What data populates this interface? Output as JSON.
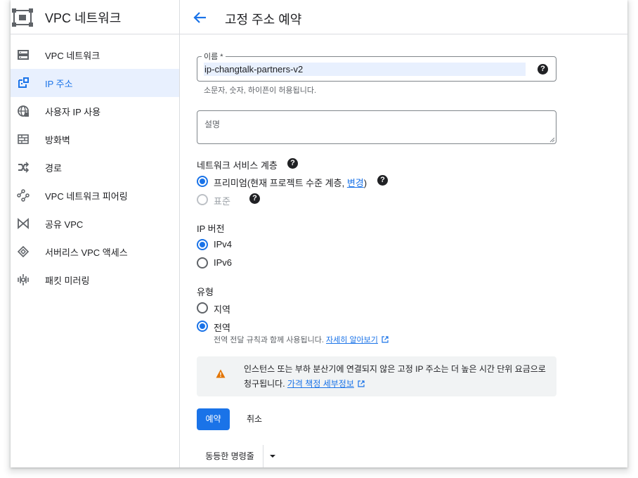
{
  "sidebar": {
    "title": "VPC 네트워크",
    "items": [
      {
        "label": "VPC 네트워크",
        "icon": "vpc-network-icon",
        "active": false
      },
      {
        "label": "IP 주소",
        "icon": "ip-address-icon",
        "active": true
      },
      {
        "label": "사용자 IP 사용",
        "icon": "globe-icon",
        "active": false
      },
      {
        "label": "방화벽",
        "icon": "firewall-icon",
        "active": false
      },
      {
        "label": "경로",
        "icon": "routes-icon",
        "active": false
      },
      {
        "label": "VPC 네트워크 피어링",
        "icon": "peering-icon",
        "active": false
      },
      {
        "label": "공유 VPC",
        "icon": "shared-vpc-icon",
        "active": false
      },
      {
        "label": "서버리스 VPC 액세스",
        "icon": "serverless-icon",
        "active": false
      },
      {
        "label": "패킷 미러링",
        "icon": "packet-mirroring-icon",
        "active": false
      }
    ]
  },
  "header": {
    "title": "고정 주소 예약"
  },
  "form": {
    "name": {
      "label": "이름 *",
      "value": "ip-changtalk-partners-v2",
      "hint": "소문자, 숫자, 하이픈이 허용됩니다."
    },
    "description": {
      "placeholder": "설명"
    },
    "tier": {
      "label": "네트워크 서비스 계층",
      "premium_label": "프리미엄(현재 프로젝트 수준 계층, ",
      "premium_link": "변경",
      "premium_suffix": ")",
      "standard_label": "표준",
      "selected": "premium"
    },
    "ip_version": {
      "label": "IP 버전",
      "options": [
        "IPv4",
        "IPv6"
      ],
      "selected": "IPv4"
    },
    "type": {
      "label": "유형",
      "options": [
        "지역",
        "전역"
      ],
      "selected": "전역",
      "global_desc": "전역 전달 규칙과 함께 사용됩니다. ",
      "global_link": "자세히 알아보기"
    },
    "warning": {
      "text": "인스턴스 또는 부하 분산기에 연결되지 않은 고정 IP 주소는 더 높은 시간 단위 요금으로 청구됩니다. ",
      "link": "가격 책정 세부정보"
    },
    "buttons": {
      "reserve": "예약",
      "cancel": "취소",
      "equivalent": "동등한 명령줄"
    }
  },
  "colors": {
    "accent": "#1a73e8",
    "active_bg": "#e8f0fe",
    "warning": "#e37400"
  }
}
